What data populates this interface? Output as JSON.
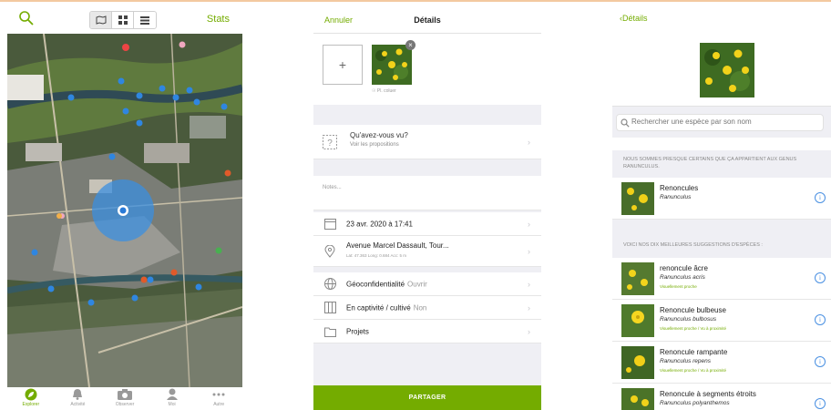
{
  "colors": {
    "accent": "#74ac00",
    "info": "#4a90e2",
    "bg_grey": "#efeff4"
  },
  "map_screen": {
    "search_icon": "search-icon",
    "view_toggle": [
      "map-view-icon",
      "grid-view-icon",
      "list-view-icon"
    ],
    "stats_label": "Stats",
    "tabs": [
      {
        "label": "Explorer",
        "icon": "leaf-icon"
      },
      {
        "label": "Activité",
        "icon": "bell-icon"
      },
      {
        "label": "Observer",
        "icon": "camera-icon"
      },
      {
        "label": "Moi",
        "icon": "person-icon"
      },
      {
        "label": "Autre",
        "icon": "more-icon"
      }
    ]
  },
  "details_screen": {
    "cancel_label": "Annuler",
    "title": "Détails",
    "add_photo_label": "+",
    "cover_label": "☉ Pl. coluer",
    "what_seen_title": "Qu'avez-vous vu?",
    "what_seen_sub": "Voir les propositions",
    "notes_placeholder": "Notes...",
    "date": "23 avr. 2020 à 17:41",
    "location": "Avenue Marcel Dassault, Tour...",
    "latlng": "Lat: 47.363 Long: 0.684 Acc: 5 m",
    "geoprivacy_label": "Géoconfidentialité",
    "geoprivacy_value": "Ouvrir",
    "captive_label": "En captivité / cultivé",
    "captive_value": "Non",
    "projects_label": "Projets",
    "share_label": "PARTAGER"
  },
  "species_screen": {
    "back_label": "Détails",
    "search_placeholder": "Rechercher une espèce par son nom",
    "genus_section": "NOUS SOMMES PRESQUE CERTAINS QUE ÇA APPARTIENT AUX GENUS RANUNCULUS.",
    "genus": {
      "name": "Renoncules",
      "sci": "Ranunculus"
    },
    "suggest_section": "VOICI NOS DIX MEILLEURES SUGGESTIONS D'ESPÈCES :",
    "suggestions": [
      {
        "name": "renoncule âcre",
        "sci": "Ranunculus acris",
        "tag": "Visuellement proche"
      },
      {
        "name": "Renoncule bulbeuse",
        "sci": "Ranunculus bulbosus",
        "tag": "Visuellement proche / Vu à proximité"
      },
      {
        "name": "Renoncule rampante",
        "sci": "Ranunculus repens",
        "tag": "Visuellement proche / Vu à proximité"
      },
      {
        "name": "Renoncule à segments étroits",
        "sci": "Ranunculus polyanthemos",
        "tag": ""
      }
    ],
    "info_glyph": "i"
  }
}
